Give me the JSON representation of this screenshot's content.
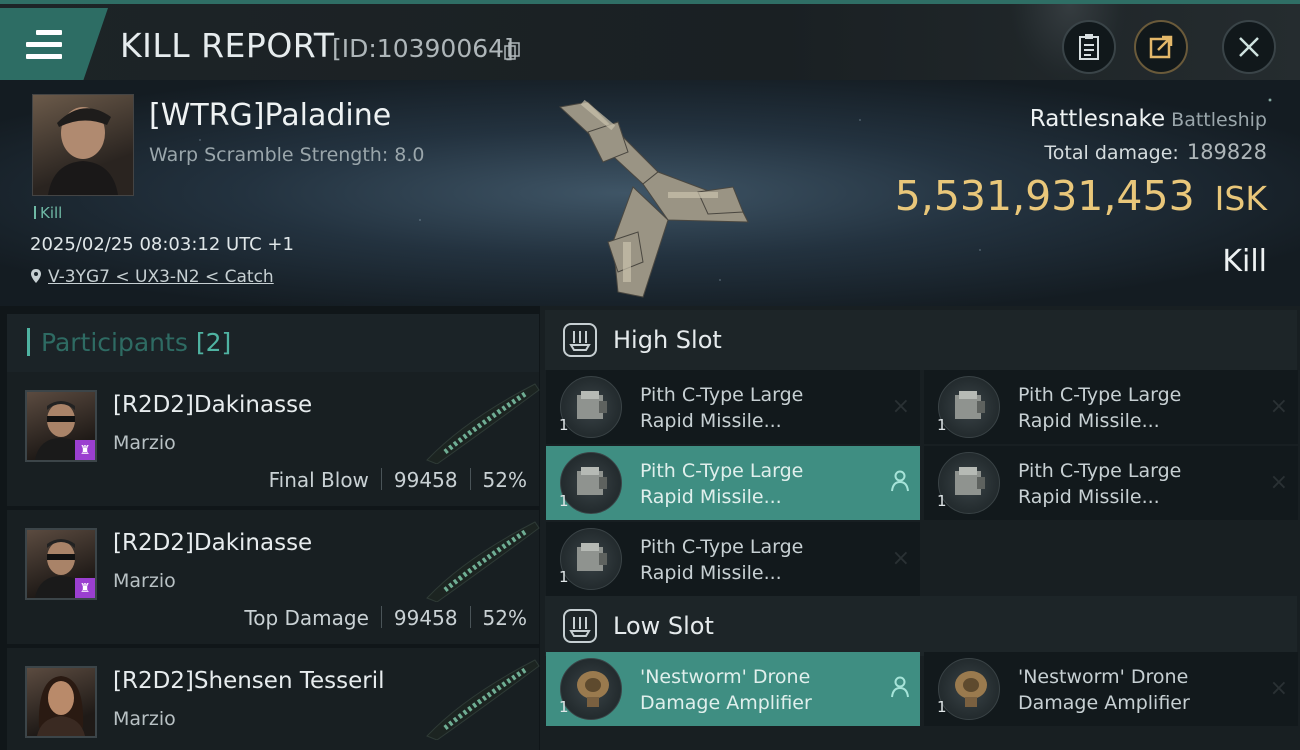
{
  "header": {
    "title": "KILL REPORT",
    "report_id": "[ID:10390064]"
  },
  "victim": {
    "name": "[WTRG]Paladine",
    "warp_strength": "Warp Scramble Strength: 8.0",
    "tag": "Kill",
    "datetime": "2025/02/25 08:03:12 UTC +1",
    "location": "V-3YG7 < UX3-N2 < Catch",
    "ship_name": "Rattlesnake",
    "ship_class": "Battleship",
    "total_damage_label": "Total damage:",
    "total_damage": "189828",
    "isk_value": "5,531,931,453",
    "isk_unit": "ISK",
    "result": "Kill"
  },
  "participants": {
    "label": "Participants",
    "count": "[2]",
    "rows": [
      {
        "name": "[R2D2]Dakinasse",
        "corp": "Marzio",
        "role": "Final Blow",
        "damage": "99458",
        "percent": "52%"
      },
      {
        "name": "[R2D2]Dakinasse",
        "corp": "Marzio",
        "role": "Top Damage",
        "damage": "99458",
        "percent": "52%"
      },
      {
        "name": "[R2D2]Shensen Tesseril",
        "corp": "Marzio",
        "role": "",
        "damage": "",
        "percent": ""
      }
    ]
  },
  "slots": {
    "high": {
      "title": "High Slot",
      "modules": [
        {
          "name": "Pith C-Type Large\nRapid Missile...",
          "qty": "1",
          "status": "×"
        },
        {
          "name": "Pith C-Type Large\nRapid Missile...",
          "qty": "1",
          "status": "×"
        },
        {
          "name": "Pith C-Type Large\nRapid Missile...",
          "qty": "1",
          "status": "person"
        },
        {
          "name": "Pith C-Type Large\nRapid Missile...",
          "qty": "1",
          "status": "×"
        },
        {
          "name": "Pith C-Type Large\nRapid Missile...",
          "qty": "1",
          "status": "×"
        }
      ]
    },
    "low": {
      "title": "Low Slot",
      "modules": [
        {
          "name": "'Nestworm' Drone\nDamage Amplifier",
          "qty": "1",
          "status": "person"
        },
        {
          "name": "'Nestworm' Drone\nDamage Amplifier",
          "qty": "1",
          "status": "×"
        }
      ]
    }
  },
  "colors": {
    "accent": "#4fb3a2",
    "isk": "#e9c77a",
    "active_module": "#3f8e82",
    "badge": "#9b3fd0"
  }
}
